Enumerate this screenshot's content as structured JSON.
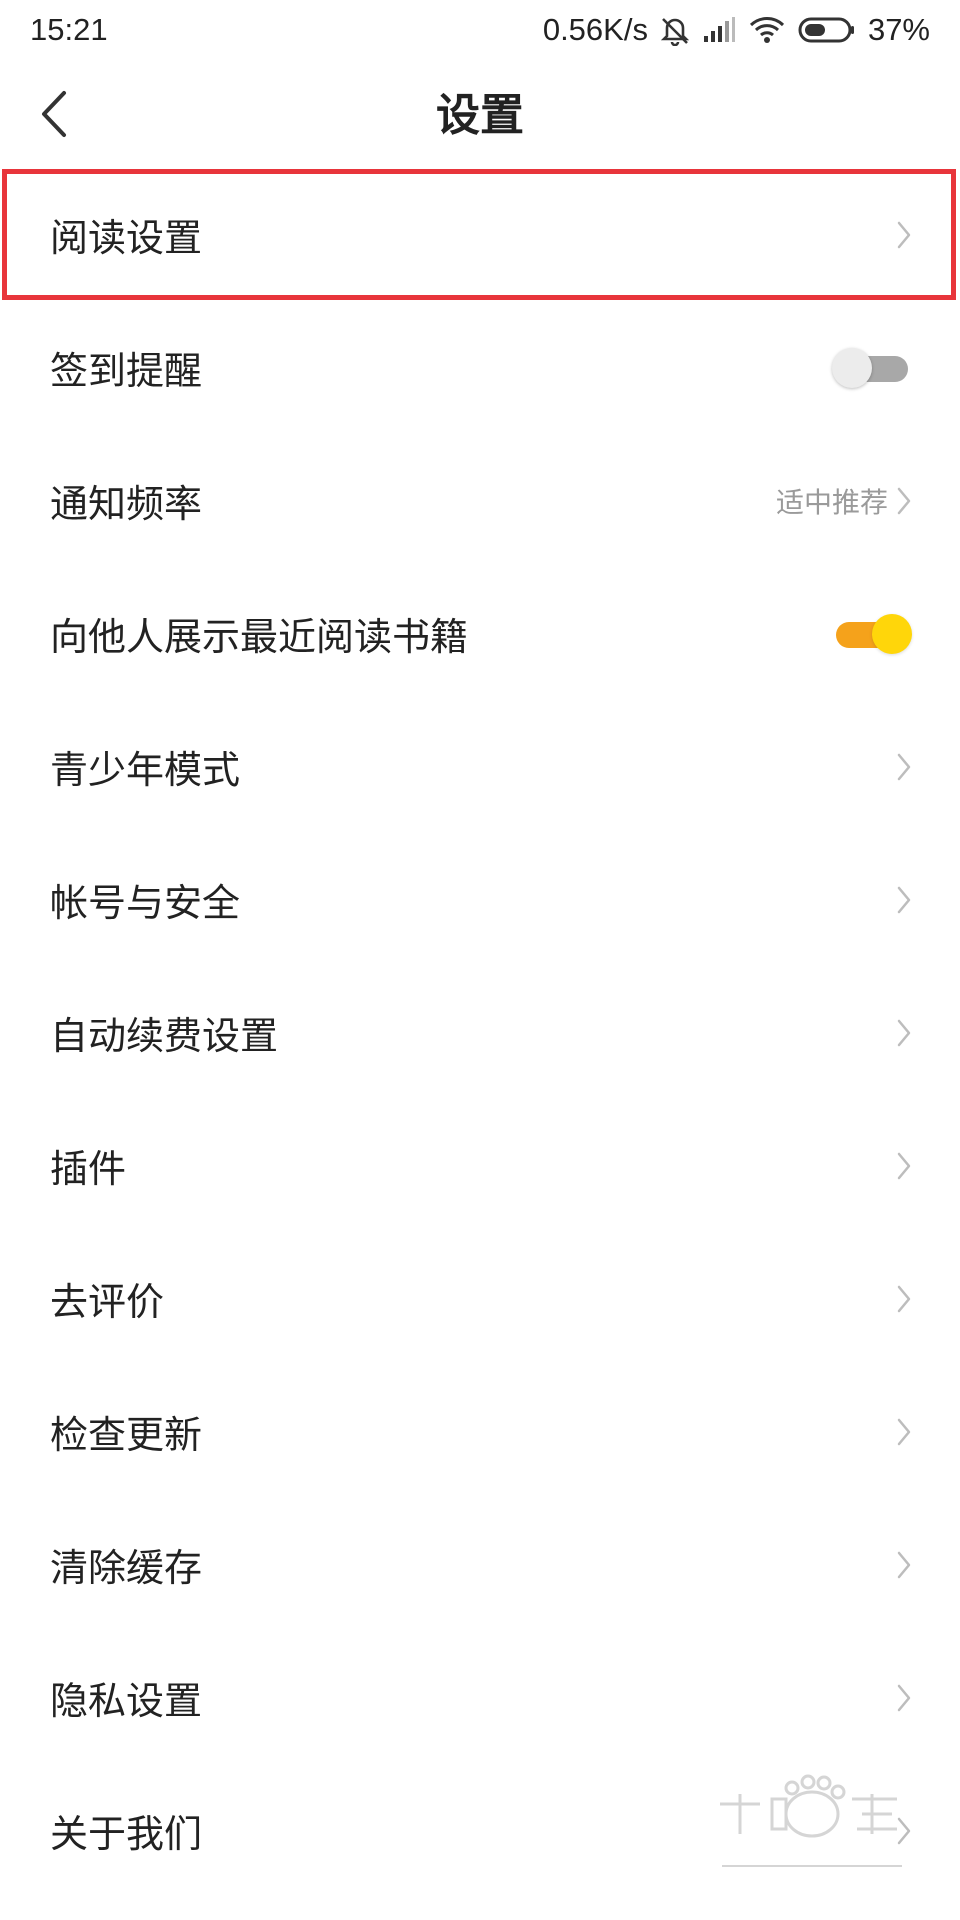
{
  "status_bar": {
    "time": "15:21",
    "network_speed": "0.56K/s",
    "battery": "37%",
    "icons": [
      "mute-bell-icon",
      "signal-icon",
      "wifi-icon",
      "battery-icon"
    ]
  },
  "nav": {
    "title": "设置",
    "back_icon": "chevron-left-icon"
  },
  "settings": {
    "items": [
      {
        "label": "阅读设置",
        "type": "link",
        "highlighted": true
      },
      {
        "label": "签到提醒",
        "type": "toggle",
        "on": false
      },
      {
        "label": "通知频率",
        "type": "link",
        "value": "适中推荐"
      },
      {
        "label": "向他人展示最近阅读书籍",
        "type": "toggle",
        "on": true
      },
      {
        "label": "青少年模式",
        "type": "link"
      },
      {
        "label": "帐号与安全",
        "type": "link"
      },
      {
        "label": "自动续费设置",
        "type": "link"
      },
      {
        "label": "插件",
        "type": "link"
      },
      {
        "label": "去评价",
        "type": "link"
      },
      {
        "label": "检查更新",
        "type": "link"
      },
      {
        "label": "清除缓存",
        "type": "link"
      },
      {
        "label": "隐私设置",
        "type": "link"
      },
      {
        "label": "关于我们",
        "type": "link"
      }
    ]
  },
  "colors": {
    "highlight_border": "#e8353b",
    "toggle_on_track": "#f5a21b",
    "toggle_on_knob": "#ffd60a",
    "toggle_off_track": "#a8a8a8",
    "secondary_text": "#9a9a9a"
  },
  "watermark": {
    "icon": "baidu-jingyan-watermark"
  }
}
